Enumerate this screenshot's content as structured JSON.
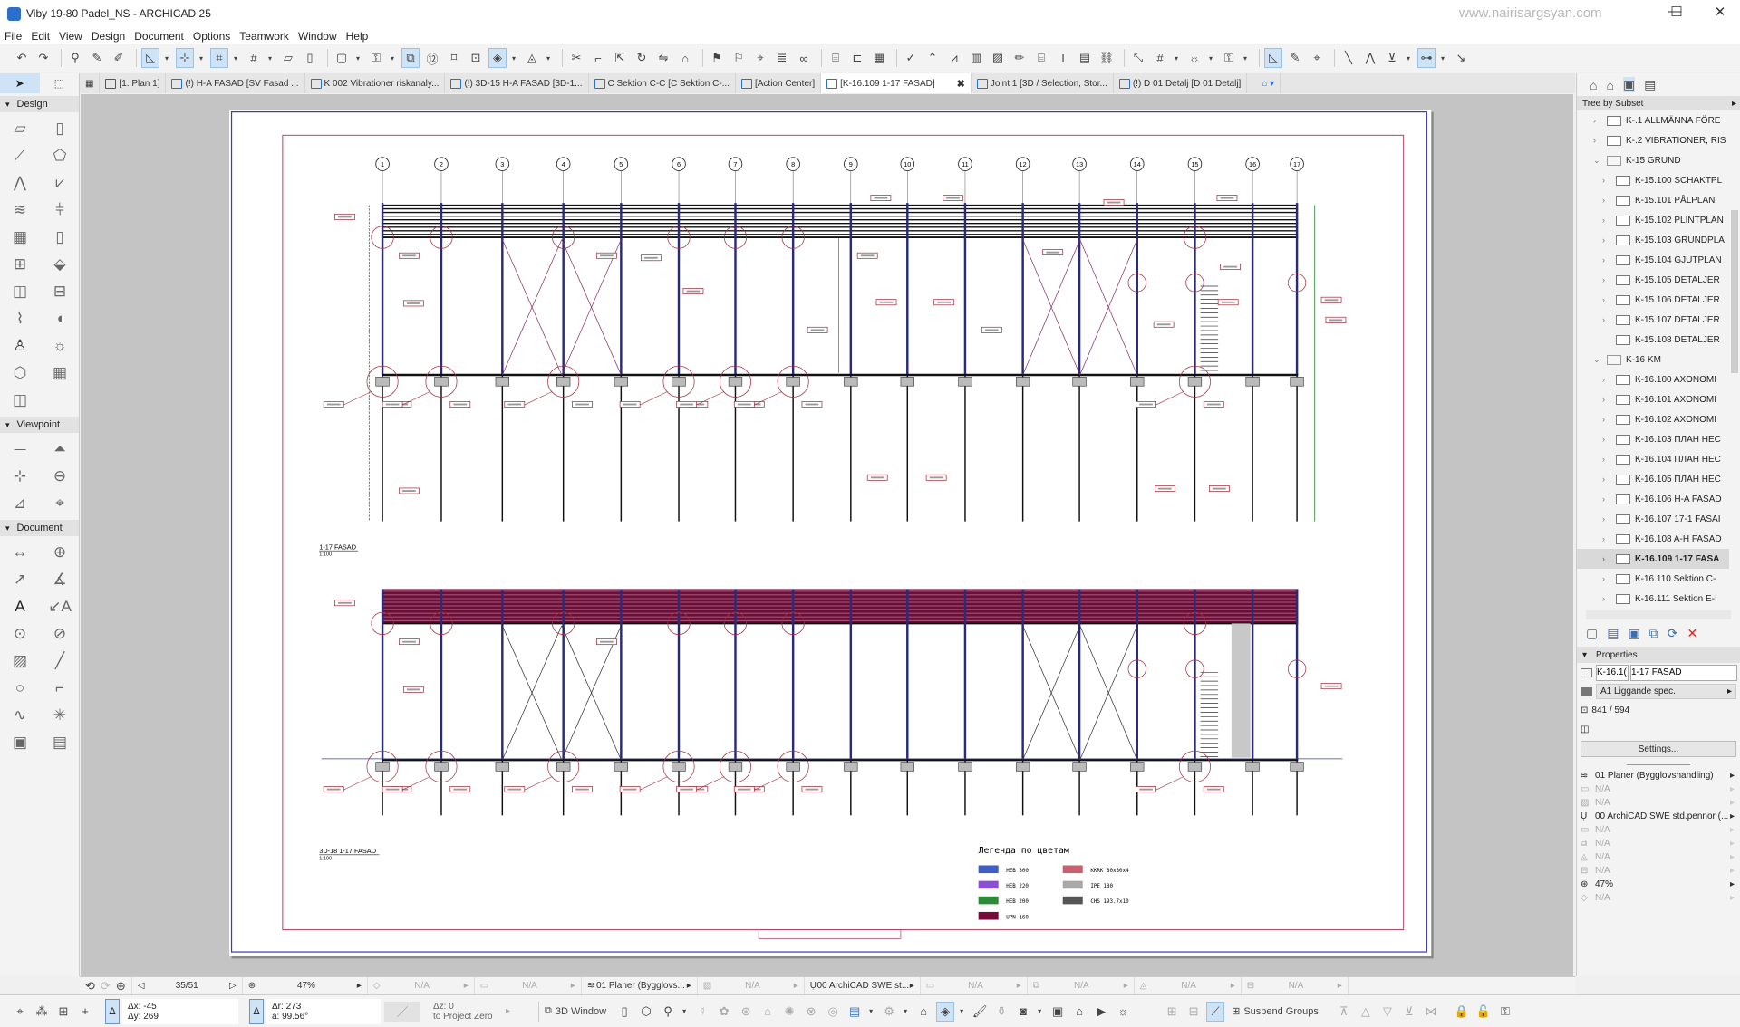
{
  "window": {
    "title": "Viby 19-80 Padel_NS - ARCHICAD 25",
    "watermark": "www.nairisargsyan.com",
    "controls": [
      "—",
      "☐",
      "✕"
    ]
  },
  "menu": [
    "File",
    "Edit",
    "View",
    "Design",
    "Document",
    "Options",
    "Teamwork",
    "Window",
    "Help"
  ],
  "toolbar": {
    "icons": [
      "undo",
      "redo",
      "|",
      "find-select",
      "eyedropper",
      "syringe",
      "|",
      "guide-line",
      "dd",
      "snap-guide",
      "dd",
      "coordinates",
      "dd",
      "grid-snap",
      "dd",
      "plane",
      "wall-line",
      "|",
      "layout-frame",
      "dd",
      "lock",
      "dd",
      "trace",
      "dimension-12",
      "cross",
      "group",
      "selection-3d",
      "dd",
      "circle-triangle",
      "dd",
      "|",
      "scissors",
      "join",
      "move",
      "rotate",
      "mirror",
      "elevate",
      "|",
      "flag",
      "marker",
      "pin",
      "stack",
      "link",
      "|",
      "stair-a",
      "door-a",
      "grid-b",
      "|",
      "check",
      "roof",
      "slope",
      "wall-3d",
      "hatch",
      "pencil",
      "stair",
      "beam",
      "table",
      "chain",
      "|",
      "resize",
      "grid",
      "dd",
      "sun",
      "dd",
      "lock-2",
      "dd",
      "|",
      "measure",
      "pencil-2",
      "cursor",
      "|",
      "line-a",
      "line-b",
      "line-c",
      "dd",
      "dim-a",
      "dd",
      "end"
    ]
  },
  "tabs": [
    {
      "label": "[1. Plan 1]"
    },
    {
      "label": "(!) H-A FASAD  [SV Fasad ..."
    },
    {
      "label": "K 002 Vibrationer riskanaly..."
    },
    {
      "label": "(!) 3D-15 H-A FASAD [3D-1..."
    },
    {
      "label": "C Sektion C-C [C Sektion C-..."
    },
    {
      "label": "[Action Center]"
    },
    {
      "label": "[K-16.109 1-17 FASAD]",
      "active": true,
      "close": "✖"
    },
    {
      "label": "Joint 1 [3D / Selection, Stor..."
    },
    {
      "label": "(!) D 01 Detalj [D 01 Detalj]"
    }
  ],
  "toolbox": {
    "sections": [
      {
        "label": "Design",
        "tools": [
          "wall",
          "column",
          "beam",
          "slab",
          "roof",
          "shell",
          "stair",
          "railing",
          "curtain-wall",
          "door",
          "window",
          "skylight",
          "corner-window",
          "wall-end",
          "mesh",
          "morph",
          "object",
          "lamp",
          "zone",
          "curtain-panel",
          "opening"
        ]
      },
      {
        "label": "Viewpoint",
        "tools": [
          "section",
          "elevation",
          "interior-elevation",
          "worksheet",
          "detail",
          "camera"
        ]
      },
      {
        "label": "Document",
        "tools": [
          "dimension",
          "level-dimension",
          "radial-dimension",
          "angle-dimension",
          "text",
          "label",
          "spot",
          "fill",
          "hatch",
          "line",
          "circle",
          "polyline",
          "spline",
          "hotspot",
          "figure",
          "drawing"
        ]
      }
    ]
  },
  "drawing": {
    "grid_labels": [
      "1",
      "2",
      "3",
      "4",
      "5",
      "6",
      "7",
      "8",
      "9",
      "10",
      "11",
      "12",
      "13",
      "14",
      "15",
      "16",
      "17"
    ],
    "views": [
      {
        "title": "1-17 FASAD",
        "scale": "1:100"
      },
      {
        "title": "3D-18 1-17 FASAD",
        "scale": "1:100"
      }
    ],
    "legend": {
      "title": "Легенда по цветам",
      "items": [
        {
          "label": "HEB 300",
          "color": "#3e5fc4"
        },
        {
          "label": "HEB 220",
          "color": "#8a4fd6"
        },
        {
          "label": "HEB 200",
          "color": "#2e8a3a"
        },
        {
          "label": "UPN 160",
          "color": "#7a0a3a"
        },
        {
          "label": "KKRK 80x80x4",
          "color": "#c8606e"
        },
        {
          "label": "IPE 180",
          "color": "#a8a8a8"
        },
        {
          "label": "CHS 193.7x10",
          "color": "#555555"
        }
      ]
    },
    "colors": {
      "frame": "#3a3ab8",
      "border": "#b04060",
      "roof_lower": "#6a1038",
      "column": "#2a2a7a",
      "tag": "#a03040",
      "grid_line": "#2e8a3a"
    }
  },
  "navigator": {
    "header": "Tree by Subset",
    "items": [
      {
        "label": "K-.1 ALLMÄNNA FÖRE",
        "level": 1,
        "exp": ">"
      },
      {
        "label": "K-.2 VIBRATIONER, RIS",
        "level": 1,
        "exp": ">"
      },
      {
        "label": "K-15 GRUND",
        "level": 1,
        "exp": "v",
        "folder": true
      },
      {
        "label": "K-15.100 SCHAKTPL",
        "level": 2,
        "exp": ">"
      },
      {
        "label": "K-15.101 PÅLPLAN",
        "level": 2,
        "exp": ">"
      },
      {
        "label": "K-15.102 PLINTPLAN",
        "level": 2,
        "exp": ">"
      },
      {
        "label": "K-15.103 GRUNDPLA",
        "level": 2,
        "exp": ">"
      },
      {
        "label": "K-15.104 GJUTPLAN",
        "level": 2,
        "exp": ">"
      },
      {
        "label": "K-15.105 DETALJER",
        "level": 2,
        "exp": ">"
      },
      {
        "label": "K-15.106 DETALJER",
        "level": 2,
        "exp": ">"
      },
      {
        "label": "K-15.107 DETALJER",
        "level": 2,
        "exp": ">"
      },
      {
        "label": "K-15.108 DETALJER",
        "level": 2,
        "exp": ""
      },
      {
        "label": "K-16 KM",
        "level": 1,
        "exp": "v",
        "folder": true
      },
      {
        "label": "K-16.100 AXONOMI",
        "level": 2,
        "exp": ">"
      },
      {
        "label": "K-16.101 AXONOMI",
        "level": 2,
        "exp": ">"
      },
      {
        "label": "K-16.102 AXONOMI",
        "level": 2,
        "exp": ">"
      },
      {
        "label": "K-16.103 ПЛАН НЕС",
        "level": 2,
        "exp": ">"
      },
      {
        "label": "K-16.104 ПЛАН НЕС",
        "level": 2,
        "exp": ">"
      },
      {
        "label": "K-16.105 ПЛАН НЕС",
        "level": 2,
        "exp": ">"
      },
      {
        "label": "K-16.106 H-A FASAD",
        "level": 2,
        "exp": ">"
      },
      {
        "label": "K-16.107 17-1 FASAI",
        "level": 2,
        "exp": ">"
      },
      {
        "label": "K-16.108 A-H FASAD",
        "level": 2,
        "exp": ">"
      },
      {
        "label": "K-16.109 1-17 FASA",
        "level": 2,
        "exp": ">",
        "selected": true
      },
      {
        "label": "K-16.110 Sektion C-",
        "level": 2,
        "exp": ">"
      },
      {
        "label": "K-16.111 Sektion E-I",
        "level": 2,
        "exp": ">"
      }
    ]
  },
  "properties": {
    "header": "Properties",
    "id": "K-16.1(",
    "name": "1-17 FASAD",
    "master": "A1 Liggande spec.",
    "size": "841 / 594",
    "settings": "Settings...",
    "rows": [
      {
        "icon": "layers",
        "value": "01 Planer (Bygglovshandling)",
        "na": false
      },
      {
        "icon": "scale",
        "value": "N/A",
        "na": true
      },
      {
        "icon": "structure",
        "value": "N/A",
        "na": true
      },
      {
        "icon": "pen",
        "value": "00 ArchiCAD SWE std.pennor (...",
        "na": false
      },
      {
        "icon": "model-view",
        "value": "N/A",
        "na": true
      },
      {
        "icon": "renovation",
        "value": "N/A",
        "na": true
      },
      {
        "icon": "design-options",
        "value": "N/A",
        "na": true
      },
      {
        "icon": "dimension",
        "value": "N/A",
        "na": true
      },
      {
        "icon": "zoom",
        "value": "47%",
        "na": false
      },
      {
        "icon": "graphic-override",
        "value": "N/A",
        "na": true
      }
    ]
  },
  "status": {
    "page": "35/51",
    "zoom": "47%",
    "fields": [
      "N/A",
      "N/A",
      "01 Planer (Bygglovs...",
      "N/A",
      "00 ArchiCAD SWE st...",
      "N/A",
      "N/A",
      "N/A",
      "N/A"
    ]
  },
  "coords": {
    "dx": "Δx: -45",
    "dy": "Δy: 269",
    "dr": "Δr: 273",
    "a": "a: 99.56°",
    "dz": "Δz: 0",
    "ref": "to Project Zero"
  },
  "bottombar": {
    "window3d": "3D Window",
    "suspend": "Suspend Groups"
  }
}
